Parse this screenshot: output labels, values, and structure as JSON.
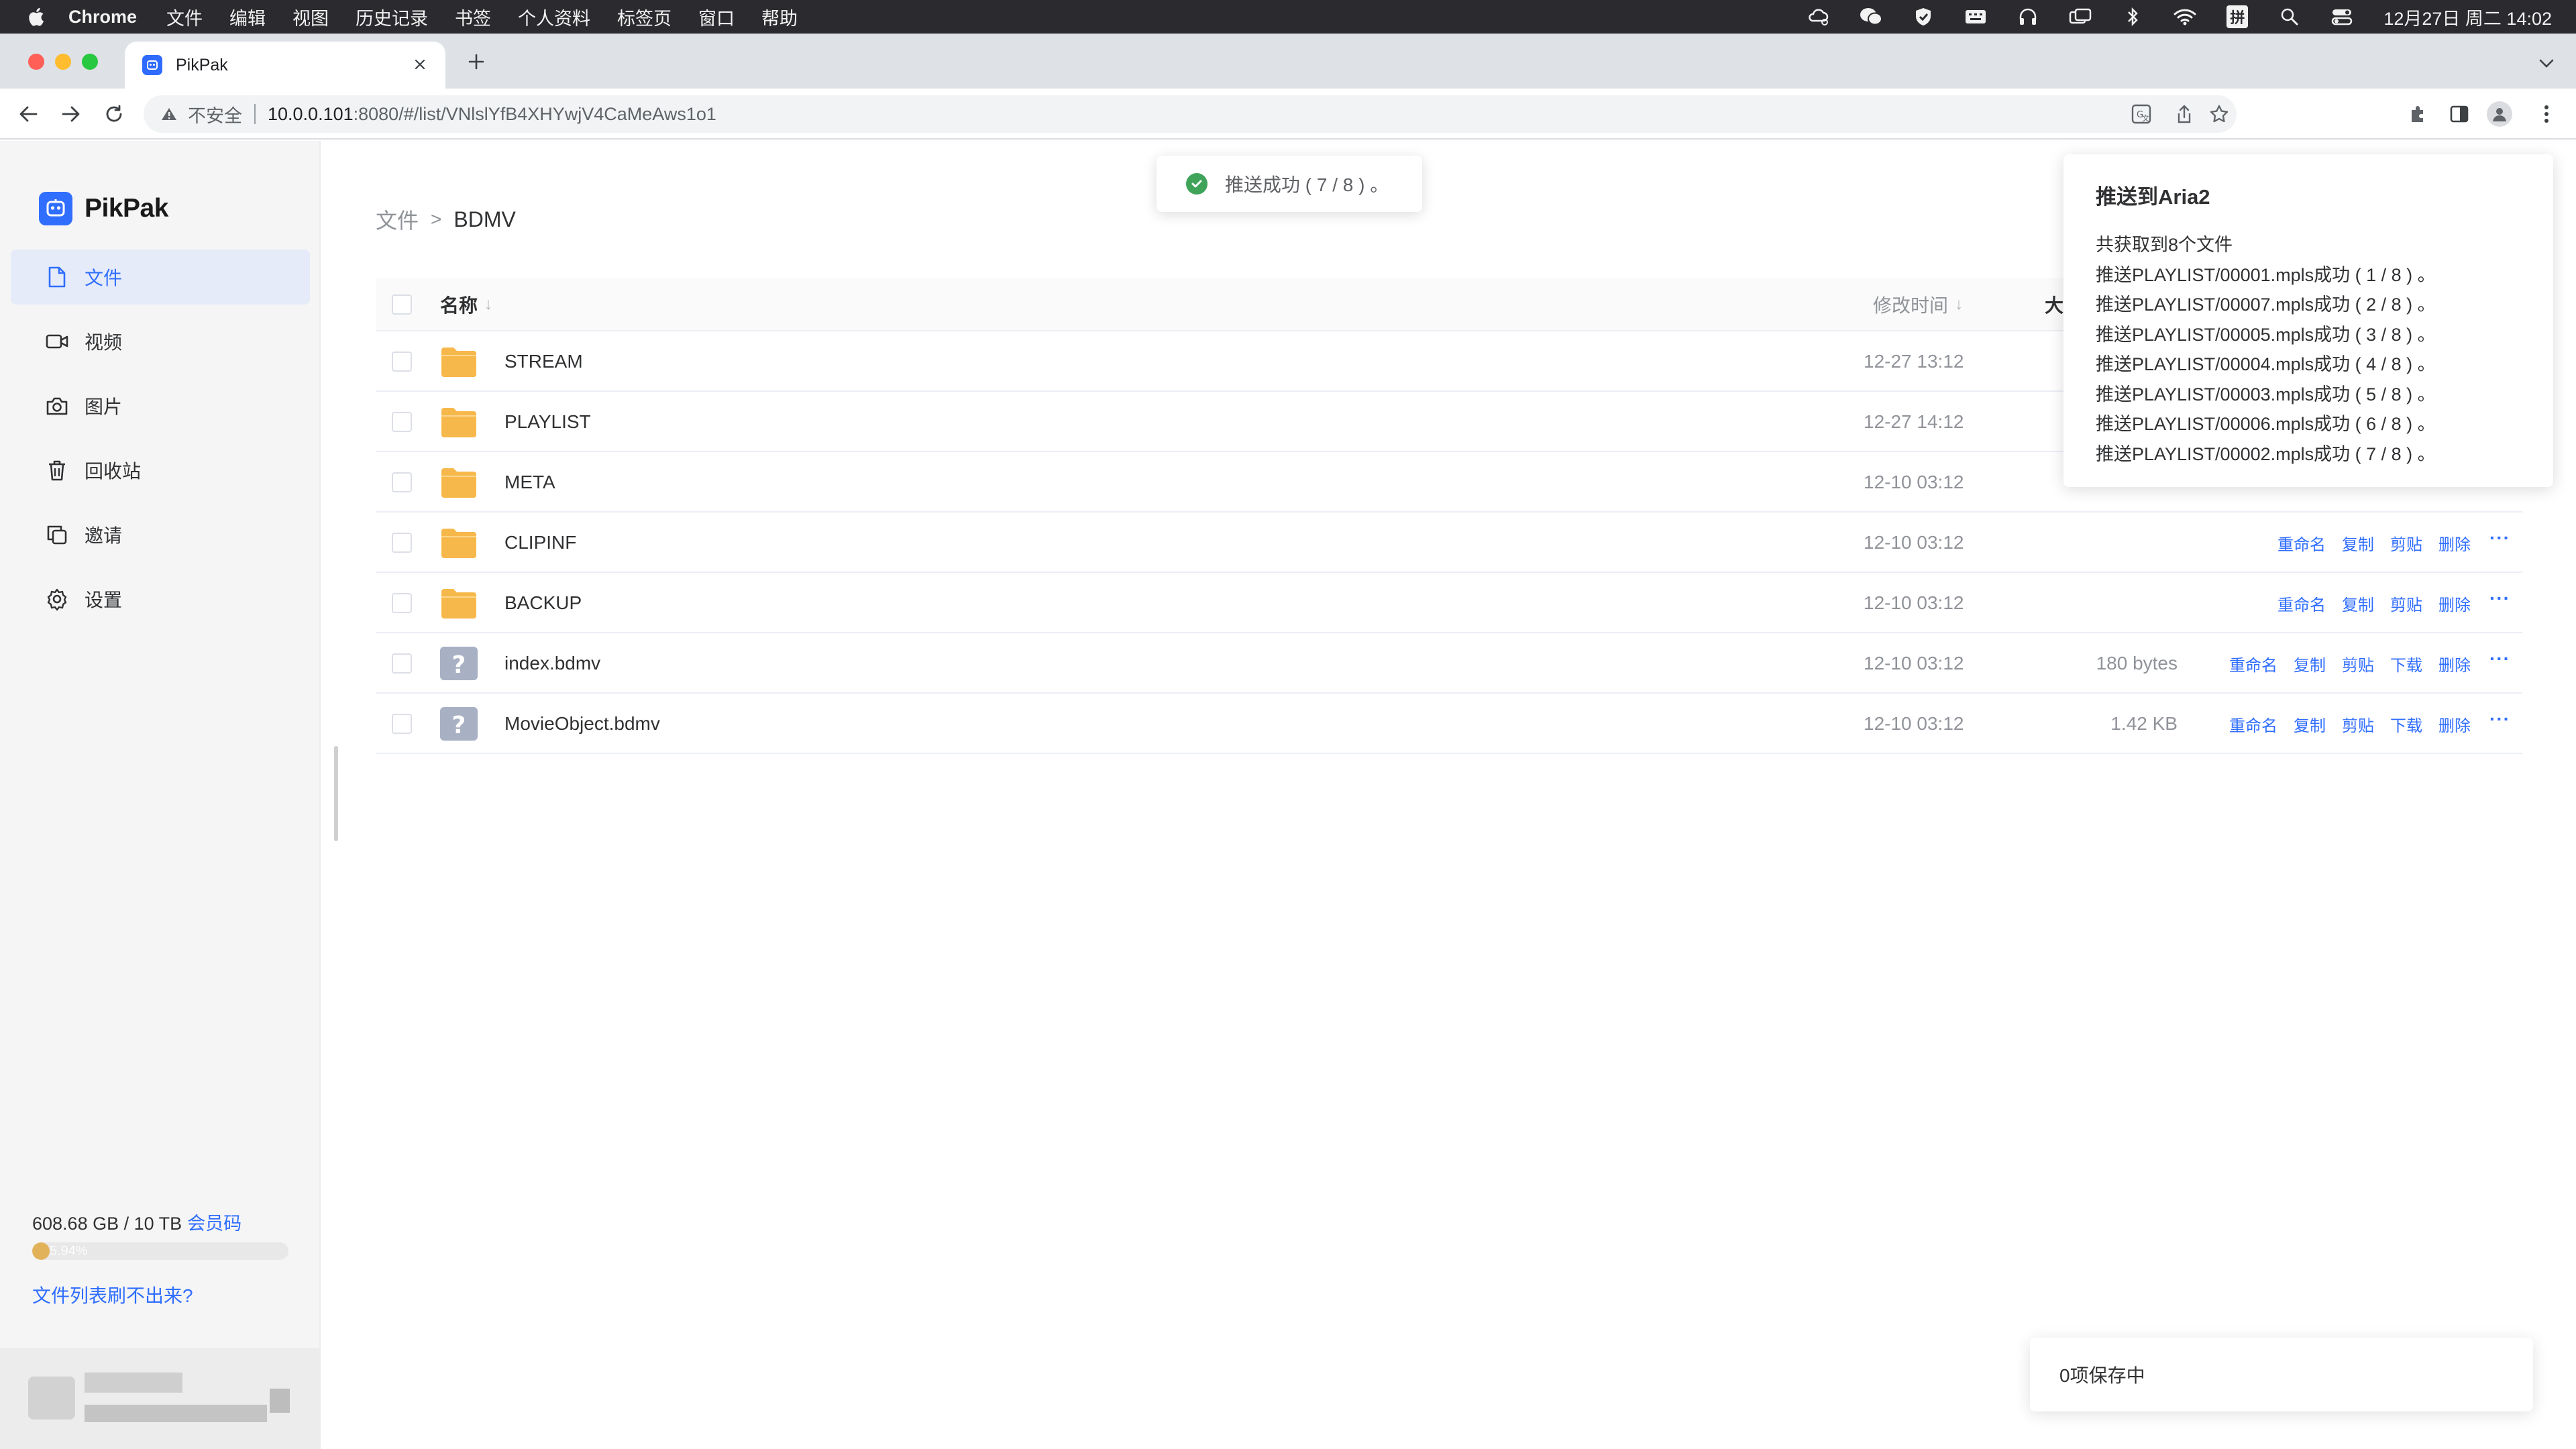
{
  "menubar": {
    "app_name": "Chrome",
    "items": [
      "文件",
      "编辑",
      "视图",
      "历史记录",
      "书签",
      "个人资料",
      "标签页",
      "窗口",
      "帮助"
    ],
    "clock": "12月27日 周二  14:02",
    "input_method": "拼"
  },
  "browser": {
    "tab_title": "PikPak",
    "security_label": "不安全",
    "url_host": "10.0.0.101",
    "url_rest": ":8080/#/list/VNlslYfB4XHYwjV4CaMeAws1o1"
  },
  "sidebar": {
    "brand": "PikPak",
    "nav": [
      {
        "label": "文件",
        "icon": "file-icon",
        "active": true
      },
      {
        "label": "视频",
        "icon": "video-icon",
        "active": false
      },
      {
        "label": "图片",
        "icon": "camera-icon",
        "active": false
      },
      {
        "label": "回收站",
        "icon": "trash-icon",
        "active": false
      },
      {
        "label": "邀请",
        "icon": "copy-icon",
        "active": false
      },
      {
        "label": "设置",
        "icon": "gear-icon",
        "active": false
      }
    ],
    "storage_text": "608.68 GB / 10 TB",
    "vip_link": "会员码",
    "storage_percent_label": "5.94%",
    "storage_fraction": 0.0594,
    "help_link": "文件列表刷不出来?"
  },
  "breadcrumb": {
    "root": "文件",
    "separator": ">",
    "current": "BDMV"
  },
  "table": {
    "headers": {
      "name": "名称",
      "mtime": "修改时间",
      "size": "大"
    },
    "rows": [
      {
        "name": "STREAM",
        "type": "folder",
        "mtime": "12-27 13:12",
        "size": ""
      },
      {
        "name": "PLAYLIST",
        "type": "folder",
        "mtime": "12-27 14:12",
        "size": ""
      },
      {
        "name": "META",
        "type": "folder",
        "mtime": "12-10 03:12",
        "size": ""
      },
      {
        "name": "CLIPINF",
        "type": "folder",
        "mtime": "12-10 03:12",
        "size": "",
        "actions": [
          "重命名",
          "复制",
          "剪贴",
          "删除"
        ]
      },
      {
        "name": "BACKUP",
        "type": "folder",
        "mtime": "12-10 03:12",
        "size": "",
        "actions": [
          "重命名",
          "复制",
          "剪贴",
          "删除"
        ]
      },
      {
        "name": "index.bdmv",
        "type": "unknown",
        "mtime": "12-10 03:12",
        "size": "180 bytes",
        "actions": [
          "重命名",
          "复制",
          "剪贴",
          "下载",
          "删除"
        ]
      },
      {
        "name": "MovieObject.bdmv",
        "type": "unknown",
        "mtime": "12-10 03:12",
        "size": "1.42 KB",
        "actions": [
          "重命名",
          "复制",
          "剪贴",
          "下载",
          "删除"
        ]
      }
    ],
    "more_label": "···"
  },
  "toast": {
    "message": "推送成功 ( 7 / 8 ) 。"
  },
  "notification": {
    "title": "推送到Aria2",
    "lines": [
      "共获取到8个文件",
      "推送PLAYLIST/00001.mpls成功 ( 1 / 8 ) 。",
      "推送PLAYLIST/00007.mpls成功 ( 2 / 8 ) 。",
      "推送PLAYLIST/00005.mpls成功 ( 3 / 8 ) 。",
      "推送PLAYLIST/00004.mpls成功 ( 4 / 8 ) 。",
      "推送PLAYLIST/00003.mpls成功 ( 5 / 8 ) 。",
      "推送PLAYLIST/00006.mpls成功 ( 6 / 8 ) 。",
      "推送PLAYLIST/00002.mpls成功 ( 7 / 8 ) 。"
    ]
  },
  "saving_notice": "0项保存中",
  "colors": {
    "accent": "#306eff",
    "folder": "#f7b84b",
    "unknown_file": "#a8b0c4",
    "success": "#3fa35a"
  }
}
